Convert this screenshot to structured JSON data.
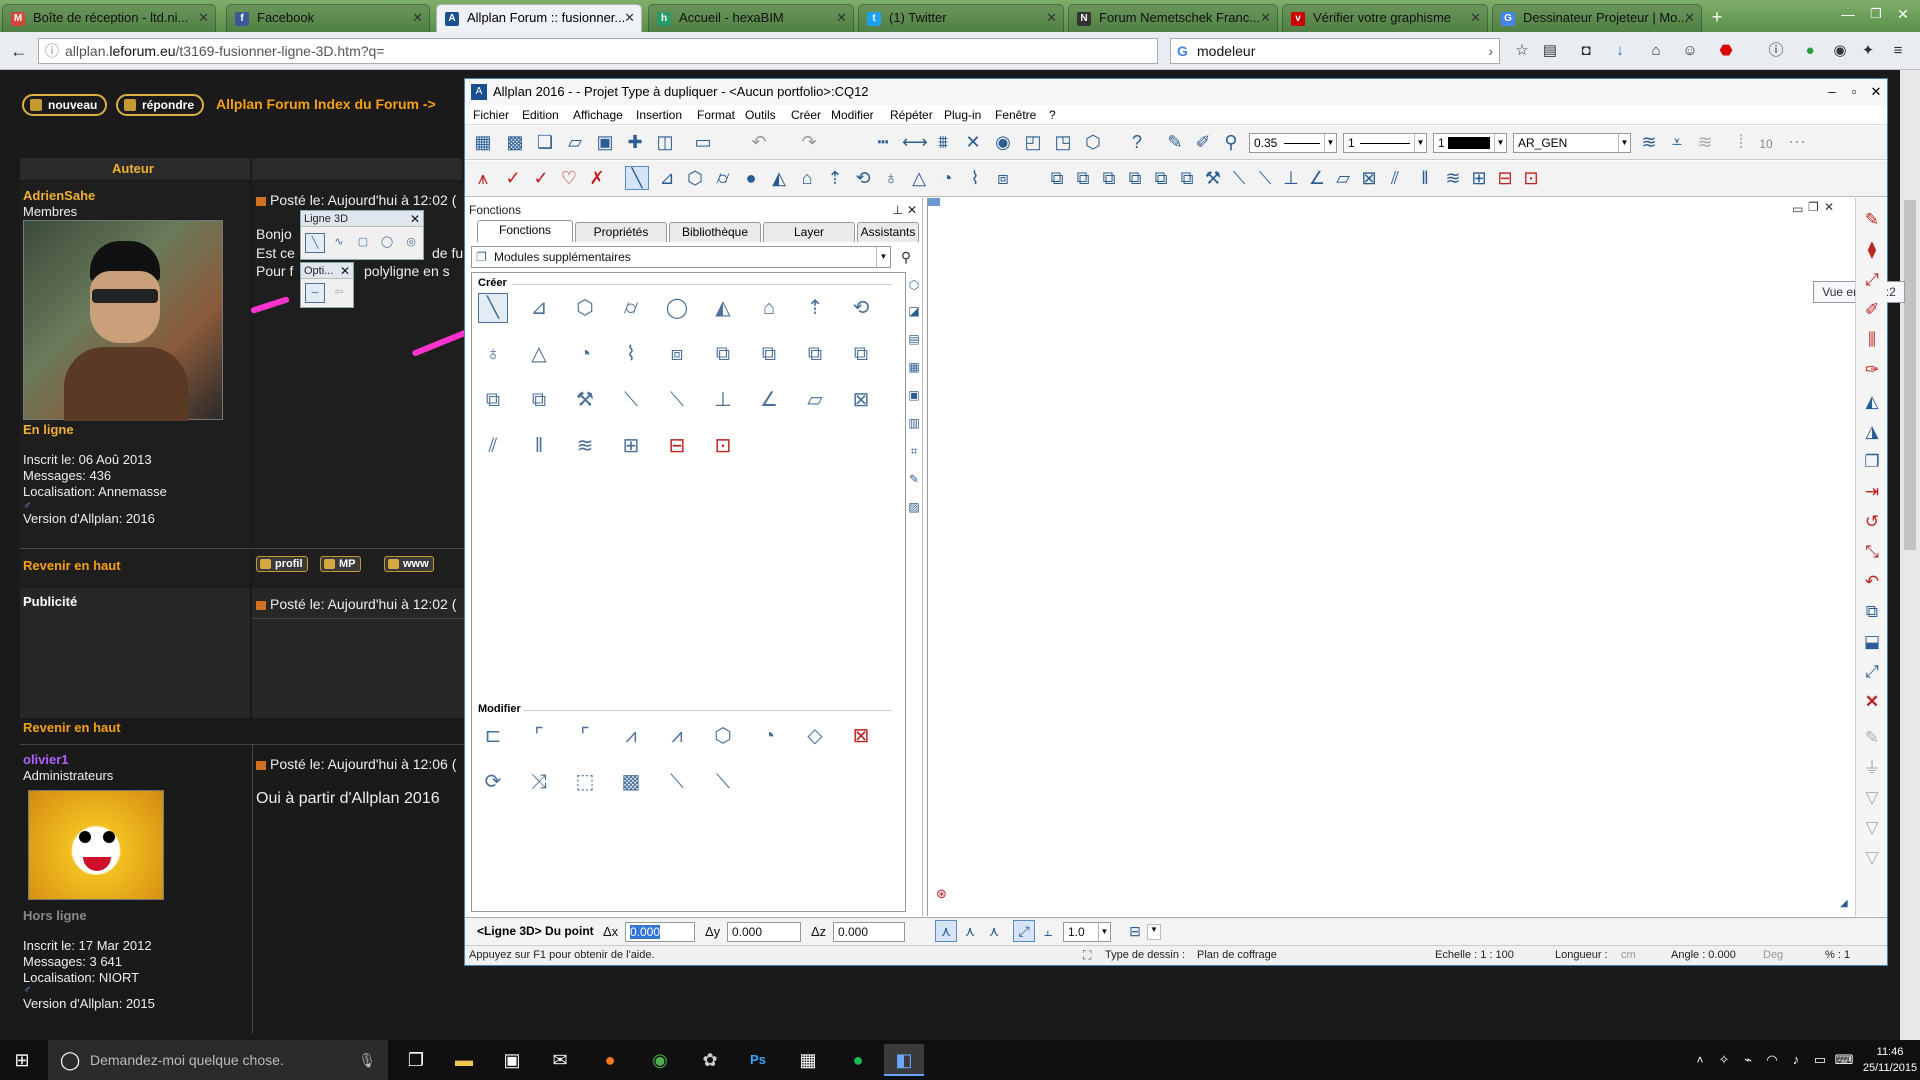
{
  "browser": {
    "tabs": [
      {
        "label": "Boîte de réception - ltd.ni...",
        "icon": "gmail-icon",
        "color": "#d44638",
        "glyph": "M"
      },
      {
        "label": "Facebook",
        "icon": "facebook-icon",
        "color": "#3b5998",
        "glyph": "f"
      },
      {
        "label": "Allplan Forum :: fusionner...",
        "icon": "allplan-icon",
        "color": "#1a4f90",
        "glyph": "A"
      },
      {
        "label": "Accueil - hexaBIM",
        "icon": "hexabim-icon",
        "color": "#2a9a6a",
        "glyph": "h"
      },
      {
        "label": "(1) Twitter",
        "icon": "twitter-icon",
        "color": "#1da1f2",
        "glyph": "t"
      },
      {
        "label": "Forum Nemetschek Franc...",
        "icon": "nemetschek-icon",
        "color": "#333333",
        "glyph": "N"
      },
      {
        "label": "Vérifier votre graphisme",
        "icon": "vistaprint-icon",
        "color": "#cc0000",
        "glyph": "v"
      },
      {
        "label": "Dessinateur Projeteur | Mo...",
        "icon": "google-icon",
        "color": "#4285f4",
        "glyph": "G"
      }
    ],
    "url_prefix": "allplan.",
    "url_domain": "leforum.eu",
    "url_path": "/t3169-fusionner-ligne-3D.htm?q=",
    "search_value": "modeleur"
  },
  "forum": {
    "btn_new": "nouveau",
    "btn_reply": "répondre",
    "breadcrumb": "Allplan Forum Index du Forum ->",
    "col_author": "Auteur",
    "post1": {
      "author": "AdrienSahe",
      "role": "Membres",
      "status": "En ligne",
      "joined": "Inscrit le: 06 Aoû 2013",
      "messages": "Messages: 436",
      "location": "Localisation: Annemasse",
      "version": "Version d'Allplan: 2016",
      "meta": "Posté le: Aujourd'hui à 12:02 (",
      "line1": "Bonjo",
      "line2": "Est ce",
      "line2b": "de fu",
      "line3": "Pour f",
      "line3b": "polyligne en s",
      "btn_profile": "profil",
      "btn_pm": "MP",
      "btn_www": "www"
    },
    "back_top": "Revenir en haut",
    "ad_label": "Publicité",
    "ad_meta": "Posté le: Aujourd'hui à 12:02 (",
    "back_top2": "Revenir en haut",
    "post2": {
      "author": "olivier1",
      "role": "Administrateurs",
      "status": "Hors ligne",
      "joined": "Inscrit le: 17 Mar 2012",
      "messages": "Messages: 3 641",
      "location": "Localisation: NIORT",
      "version": "Version d'Allplan: 2015",
      "meta": "Posté le: Aujourd'hui à 12:06 (",
      "text": "Oui à partir d'Allplan 2016"
    },
    "float1_title": "Ligne 3D",
    "float2_title": "Opti..."
  },
  "allplan": {
    "title": "Allplan 2016 - - Projet Type à dupliquer - <Aucun portfolio>:CQ12",
    "menu": [
      "Fichier",
      "Edition",
      "Affichage",
      "Insertion",
      "Format",
      "Outils",
      "Créer",
      "Modifier",
      "Répéter",
      "Plug-in",
      "Fenêtre",
      "?"
    ],
    "pen_value": "0.35",
    "line_value": "1",
    "color_value": "1",
    "layer_value": "AR_GEN",
    "num_value": "10",
    "panel_title": "Fonctions",
    "panel_tabs": [
      "Fonctions",
      "Propriétés",
      "Bibliothèque",
      "Layer",
      "Assistants"
    ],
    "module_select": "Modules supplémentaires",
    "section_create": "Créer",
    "section_modify": "Modifier",
    "tooltip": "Vue en plan:2",
    "input_prompt": "<Ligne 3D> Du point",
    "dx_label": "Δx",
    "dx_value": "0.000",
    "dy_label": "Δy",
    "dy_value": "0.000",
    "dz_label": "Δz",
    "dz_value": "0.000",
    "scale_value": "1.0",
    "status_help": "Appuyez sur F1 pour obtenir de l'aide.",
    "status_type_label": "Type de dessin :",
    "status_type_value": "Plan de coffrage",
    "status_scale": "Echelle : 1 : 100",
    "status_length_label": "Longueur :",
    "status_length_unit": "cm",
    "status_angle": "Angle : 0.000",
    "status_angle_unit": "Deg",
    "status_percent": "% : 1"
  },
  "taskbar": {
    "search_placeholder": "Demandez-moi quelque chose.",
    "time": "11:46",
    "date": "25/11/2015"
  },
  "colors": {
    "accent": "#f5a010",
    "pink_mark": "#ff33cc",
    "allplan_blue": "#1a4f90"
  }
}
